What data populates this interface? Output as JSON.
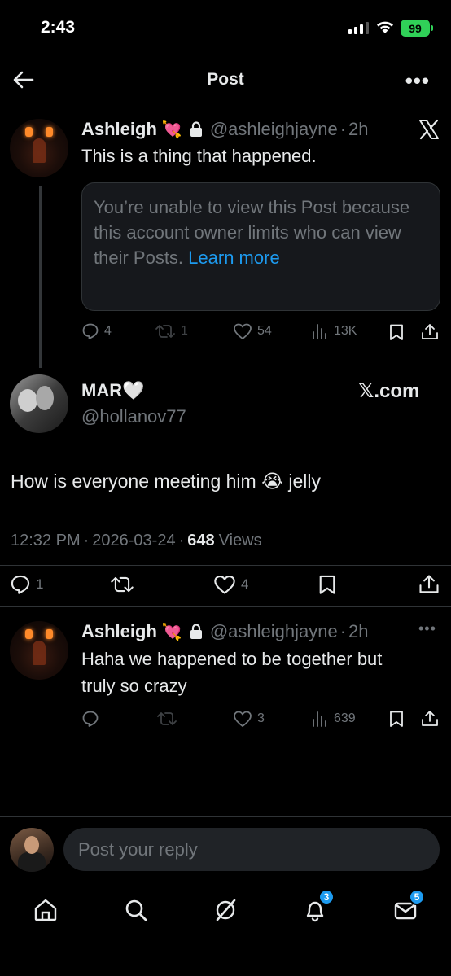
{
  "status": {
    "time": "2:43",
    "battery": "99"
  },
  "header": {
    "title": "Post"
  },
  "quoted_post": {
    "name": "Ashleigh",
    "emoji": "💘",
    "handle": "@ashleighjayne",
    "dot": "·",
    "time": "2h",
    "text": "This is a thing that happened.",
    "limited_notice": "You’re unable to view this Post because this account owner limits who can view their Posts.",
    "learn_more": "Learn more",
    "stats": {
      "replies": "4",
      "reposts": "1",
      "likes": "54",
      "views": "13K"
    }
  },
  "main_post": {
    "name": "MAR🤍",
    "handle": "@hollanov77",
    "watermark": "𝕏.com",
    "text": "How is everyone meeting him 😭 jelly",
    "meta_time": "12:32 PM",
    "meta_date": "2026-03-24",
    "dot": "·",
    "views_count": "648",
    "views_label": "Views",
    "stats": {
      "replies": "1",
      "likes": "4"
    }
  },
  "reply_post": {
    "name": "Ashleigh",
    "emoji": "💘",
    "handle": "@ashleighjayne",
    "dot": "·",
    "time": "2h",
    "text_line1": "Haha we happened to be together but",
    "text_line2": "truly so crazy",
    "stats": {
      "likes": "3",
      "views": "639"
    }
  },
  "composer": {
    "placeholder": "Post your reply"
  },
  "tabbar": {
    "notifications_badge": "3",
    "messages_badge": "5"
  },
  "colors": {
    "accent": "#1d9bf0",
    "muted": "#71767b",
    "background": "#000000"
  }
}
